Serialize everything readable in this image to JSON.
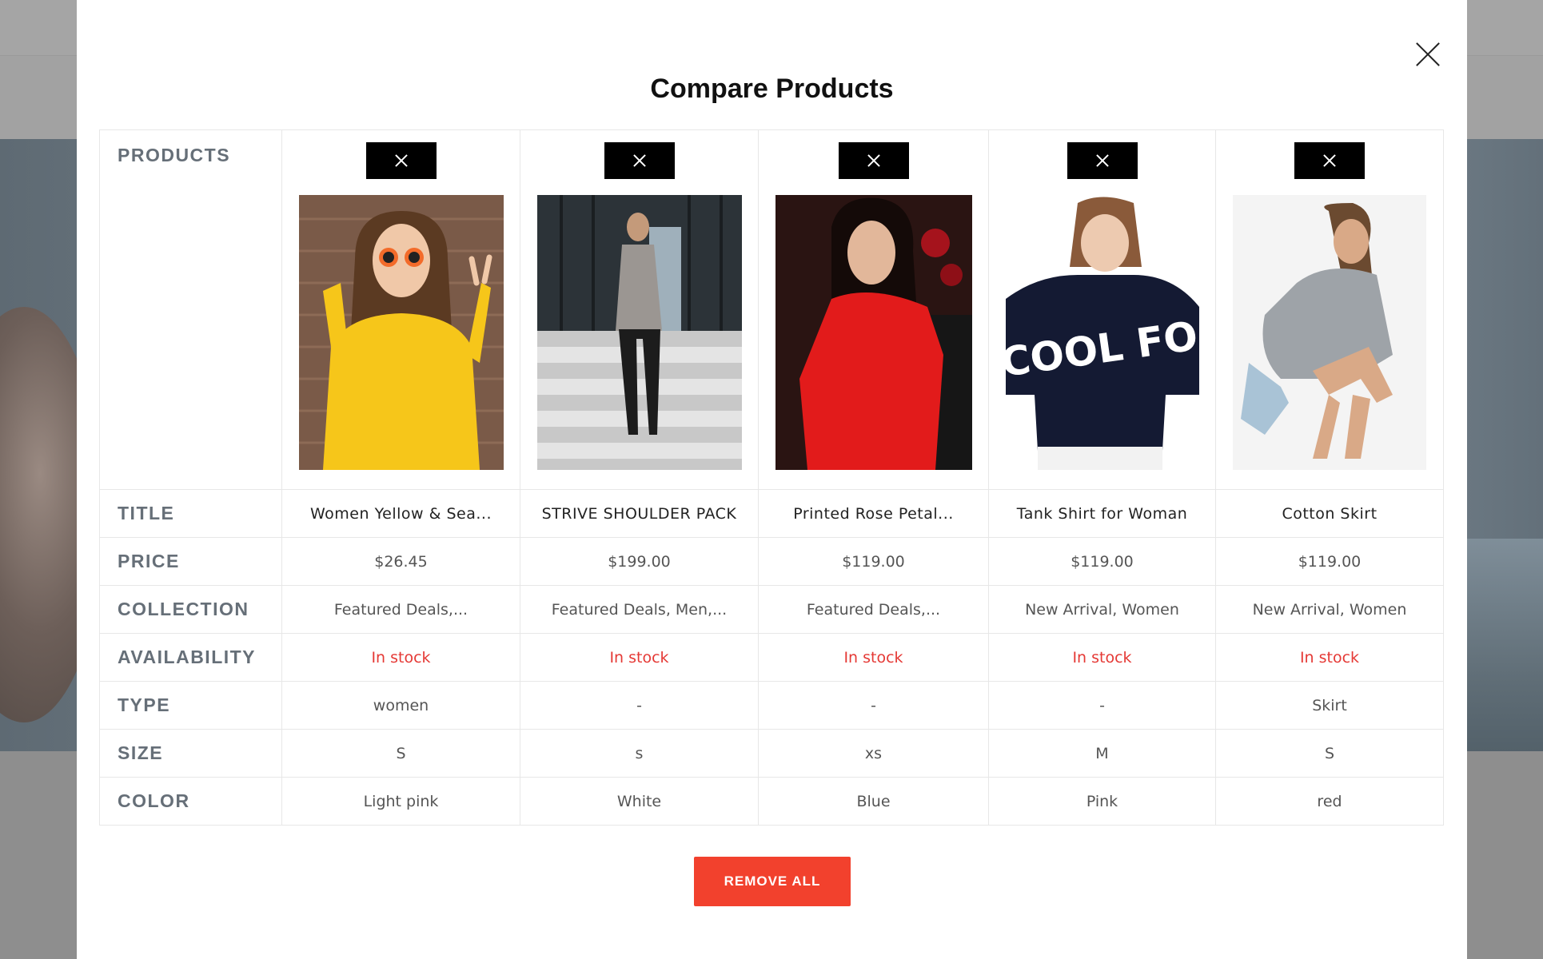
{
  "modal": {
    "title": "Compare Products",
    "remove_all_label": "REMOVE ALL"
  },
  "labels": {
    "products": "PRODUCTS",
    "title": "TITLE",
    "price": "PRICE",
    "collection": "COLLECTION",
    "availability": "AVAILABILITY",
    "type": "TYPE",
    "size": "SIZE",
    "color": "COLOR"
  },
  "products": [
    {
      "title": "Women Yellow & Sea...",
      "price": "$26.45",
      "collection": "Featured Deals,...",
      "availability": "In stock",
      "type": "women",
      "size": "S",
      "color": "Light pink"
    },
    {
      "title": "STRIVE SHOULDER PACK",
      "price": "$199.00",
      "collection": "Featured Deals, Men,...",
      "availability": "In stock",
      "type": "-",
      "size": "s",
      "color": "White"
    },
    {
      "title": "Printed Rose Petal...",
      "price": "$119.00",
      "collection": "Featured Deals,...",
      "availability": "In stock",
      "type": "-",
      "size": "xs",
      "color": "Blue"
    },
    {
      "title": "Tank Shirt for Woman",
      "price": "$119.00",
      "collection": "New Arrival, Women",
      "availability": "In stock",
      "type": "-",
      "size": "M",
      "color": "Pink"
    },
    {
      "title": "Cotton Skirt",
      "price": "$119.00",
      "collection": "New Arrival, Women",
      "availability": "In stock",
      "type": "Skirt",
      "size": "S",
      "color": "red"
    }
  ],
  "image_text": {
    "shirt_print": "COOL FO"
  },
  "colors": {
    "accent": "#f2412d",
    "stock": "#e53935"
  }
}
